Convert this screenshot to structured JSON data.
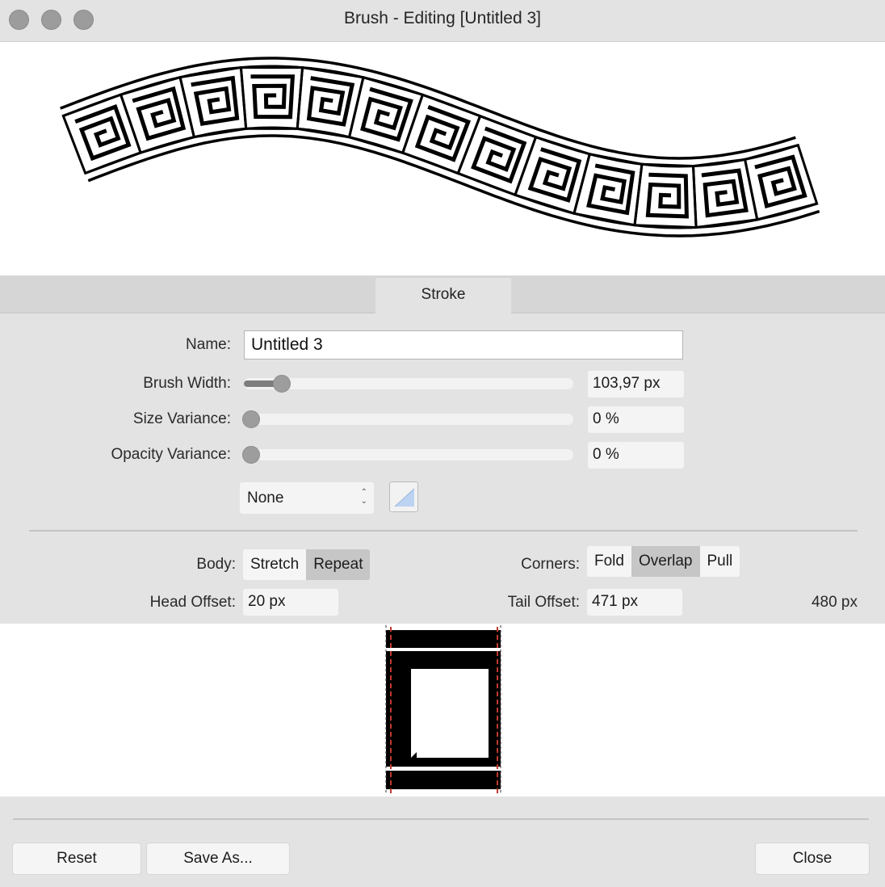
{
  "window": {
    "title": "Brush - Editing [Untitled 3]"
  },
  "tabs": [
    {
      "label": "Stroke",
      "selected": true
    }
  ],
  "form": {
    "name_label": "Name:",
    "name_value": "Untitled 3",
    "brush_width": {
      "label": "Brush Width:",
      "value": "103,97 px",
      "slider_fraction": 0.11
    },
    "size_variance": {
      "label": "Size Variance:",
      "value": "0 %",
      "slider_fraction": 0
    },
    "opacity_variance": {
      "label": "Opacity Variance:",
      "value": "0 %",
      "slider_fraction": 0
    },
    "controller_select": {
      "value": "None"
    }
  },
  "body": {
    "label": "Body:",
    "options": [
      "Stretch",
      "Repeat"
    ],
    "selected": "Repeat"
  },
  "corners": {
    "label": "Corners:",
    "options": [
      "Fold",
      "Overlap",
      "Pull"
    ],
    "selected": "Overlap"
  },
  "offsets": {
    "head_label": "Head Offset:",
    "head_value": "20 px",
    "tail_label": "Tail Offset:",
    "tail_value": "471 px",
    "total": "480 px"
  },
  "buttons": {
    "reset": "Reset",
    "save_as": "Save As...",
    "close": "Close"
  },
  "colors": {
    "window_bg": "#e3e3e3",
    "canvas_bg": "#ffffff",
    "stroke": "#000000",
    "guide_line": "#c0392b"
  },
  "icons": [
    "window-close-icon",
    "window-minimize-icon",
    "window-zoom-icon",
    "stepper-arrows-icon",
    "pressure-curve-icon"
  ]
}
